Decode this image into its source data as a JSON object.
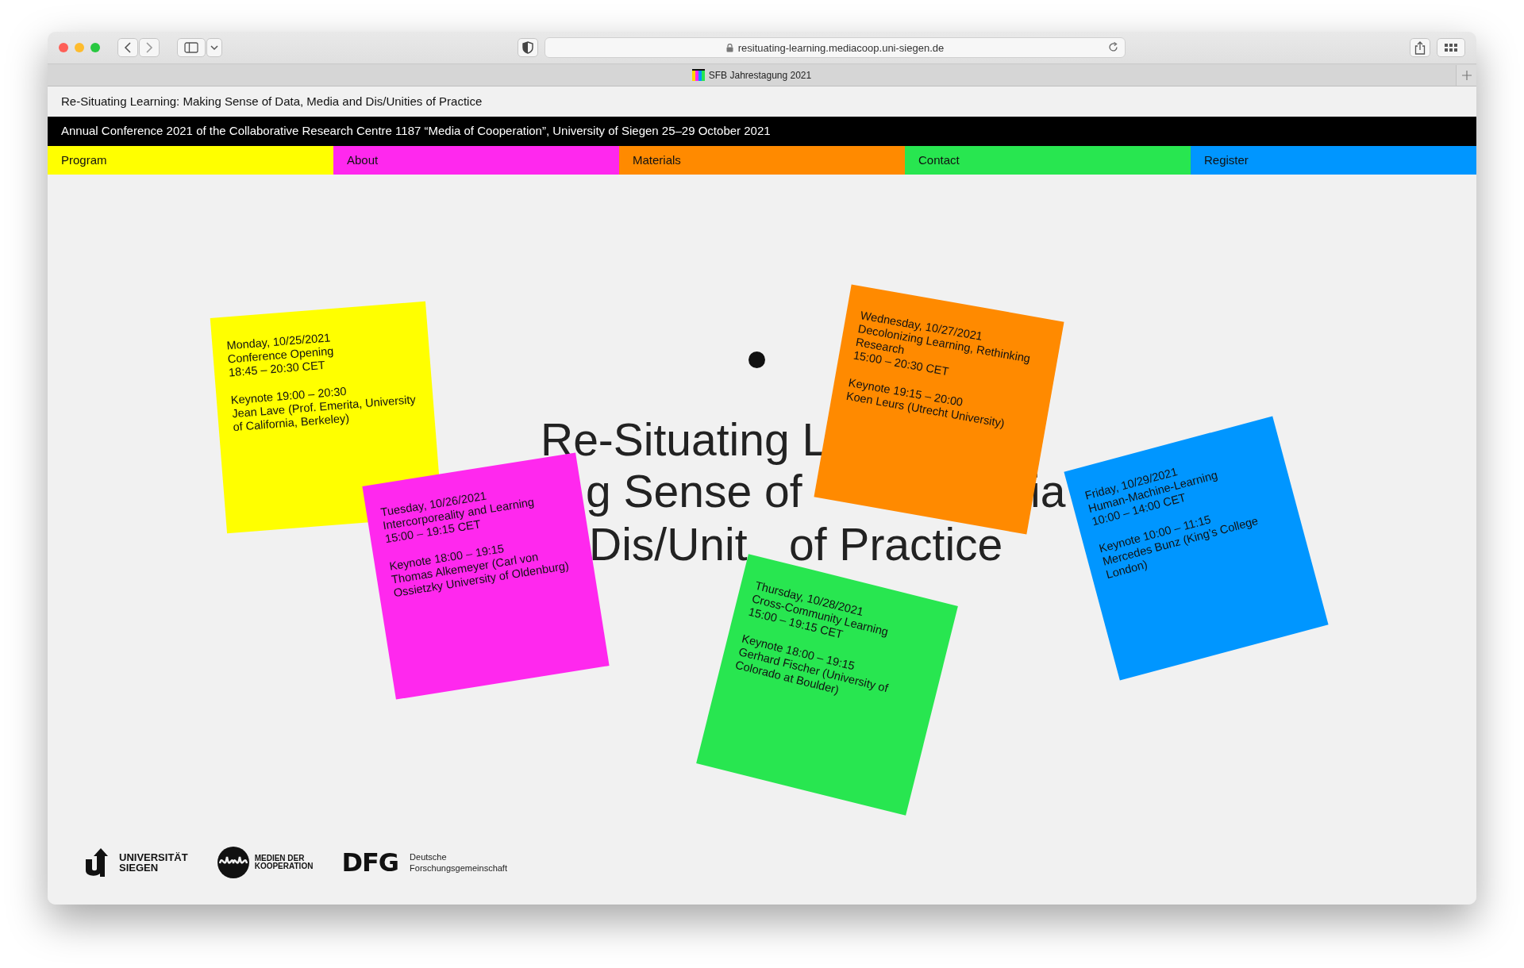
{
  "browser": {
    "url": "resituating-learning.mediacoop.uni-siegen.de",
    "tab": "SFB Jahrestagung 2021"
  },
  "site_title": "Re-Situating Learning: Making Sense of Data, Media and Dis/Unities of Practice",
  "banner": "Annual Conference 2021 of the Collaborative Research Centre 1187 “Media of Cooperation”, University of Siegen 25–29 October 2021",
  "nav": [
    {
      "label": "Program",
      "color": "#ffff00"
    },
    {
      "label": "About",
      "color": "#ff28ee"
    },
    {
      "label": "Materials",
      "color": "#ff8a00"
    },
    {
      "label": "Contact",
      "color": "#28e650"
    },
    {
      "label": "Register",
      "color": "#0096ff"
    }
  ],
  "headline": [
    [
      "Re-Situating L"
    ],
    [
      "g Sense of",
      "ia"
    ],
    [
      "Dis/Unit",
      "of Practice"
    ]
  ],
  "notes": [
    {
      "color": "#ffff00",
      "date": "Monday, 10/25/2021",
      "title": "Conference Opening",
      "time": "18:45 – 20:30 CET",
      "keynote": "Keynote 19:00 – 20:30",
      "speaker": "Jean Lave (Prof. Emerita, University of California, Berkeley)"
    },
    {
      "color": "#ff28ee",
      "date": "Tuesday, 10/26/2021",
      "title": "Intercorporeality and Learning",
      "time": "15:00 – 19:15 CET",
      "keynote": "Keynote 18:00 – 19:15",
      "speaker": "Thomas Alkemeyer (Carl von Ossietzky University of Oldenburg)"
    },
    {
      "color": "#ff8a00",
      "date": "Wednesday, 10/27/2021",
      "title": "Decolonizing Learning, Rethinking Research",
      "time": "15:00 – 20:30 CET",
      "keynote": "Keynote 19:15 – 20:00",
      "speaker": "Koen Leurs (Utrecht University)"
    },
    {
      "color": "#28e650",
      "date": "Thursday, 10/28/2021",
      "title": "Cross-Community Learning",
      "time": "15:00 – 19:15 CET",
      "keynote": "Keynote 18:00 – 19:15",
      "speaker": "Gerhard Fischer (University of Colorado at Boulder)"
    },
    {
      "color": "#0096ff",
      "date": "Friday, 10/29/2021",
      "title": "Human-Machine-Learning",
      "time": "10:00 – 14:00 CET",
      "keynote": "Keynote 10:00 – 11:15",
      "speaker": "Mercedes Bunz (King’s College London)"
    }
  ],
  "logos": [
    {
      "kind": "siegen",
      "lines": [
        "UNIVERSITÄT",
        "SIEGEN"
      ]
    },
    {
      "kind": "mediacoop",
      "lines": [
        "MEDIEN DER",
        "KOOPERATION"
      ]
    },
    {
      "kind": "dfg",
      "mark": "DFG",
      "lines": [
        "Deutsche",
        "Forschungsgemeinschaft"
      ]
    }
  ]
}
